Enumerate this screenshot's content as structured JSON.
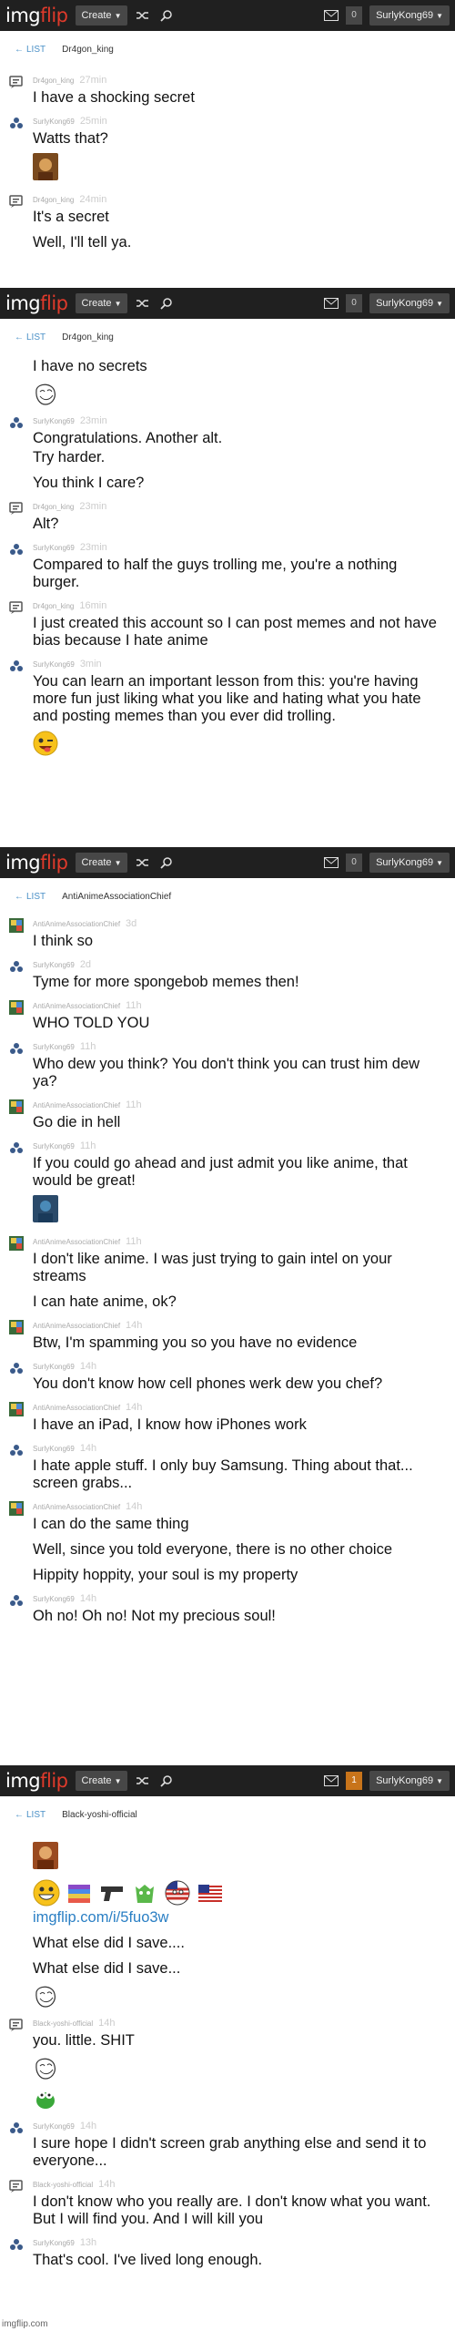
{
  "topbar": {
    "logo_main": "img",
    "logo_accent": "flip",
    "create_label": "Create",
    "username": "SurlyKong69",
    "notifications_panel1": "0",
    "notifications_panel4": "1"
  },
  "back_label": "LIST",
  "panel1": {
    "conversation": "Dr4gon_king",
    "messages": [
      {
        "user": "Dr4gon_king",
        "time": "27min",
        "lines": [
          "I have a shocking secret"
        ]
      },
      {
        "user": "SurlyKong69",
        "time": "25min",
        "lines": [
          "Watts that?"
        ]
      },
      {
        "user": "Dr4gon_king",
        "time": "24min",
        "lines": [
          "It's a secret",
          "Well, I'll tell ya."
        ]
      }
    ]
  },
  "panel2": {
    "conversation": "Dr4gon_king",
    "messages": [
      {
        "lines": [
          "I have no secrets"
        ]
      },
      {
        "user": "SurlyKong69",
        "time": "23min",
        "lines": [
          "Congratulations. Another alt.",
          "Try harder.",
          "You think I care?"
        ]
      },
      {
        "user": "Dr4gon_king",
        "time": "23min",
        "lines": [
          "Alt?"
        ]
      },
      {
        "user": "SurlyKong69",
        "time": "23min",
        "lines": [
          "Compared to half the guys trolling me, you're a nothing burger."
        ]
      },
      {
        "user": "Dr4gon_king",
        "time": "16min",
        "lines": [
          "I just created this account so I can post memes and not have bias because I hate anime"
        ]
      },
      {
        "user": "SurlyKong69",
        "time": "3min",
        "lines": [
          "You can learn an important lesson from this: you're having more fun just liking what you like and hating what you hate and posting memes than you ever did trolling."
        ]
      }
    ]
  },
  "panel3": {
    "conversation": "AntiAnimeAssociationChief",
    "messages": [
      {
        "user": "AntiAnimeAssociationChief",
        "time": "3d",
        "lines": [
          "I think so"
        ]
      },
      {
        "user": "SurlyKong69",
        "time": "2d",
        "lines": [
          "Tyme for more spongebob memes then!"
        ]
      },
      {
        "user": "AntiAnimeAssociationChief",
        "time": "11h",
        "lines": [
          "WHO TOLD YOU"
        ]
      },
      {
        "user": "SurlyKong69",
        "time": "11h",
        "lines": [
          "Who dew you think? You don't think you can trust him dew ya?"
        ]
      },
      {
        "user": "AntiAnimeAssociationChief",
        "time": "11h",
        "lines": [
          "Go die in hell"
        ]
      },
      {
        "user": "SurlyKong69",
        "time": "11h",
        "lines": [
          "If you could go ahead and just admit you like anime, that would be great!"
        ]
      },
      {
        "user": "AntiAnimeAssociationChief",
        "time": "11h",
        "lines": [
          "I don't like anime. I was just trying to gain intel on your streams",
          "I can hate anime, ok?"
        ]
      },
      {
        "user": "AntiAnimeAssociationChief",
        "time": "14h",
        "lines": [
          "Btw, I'm spamming you so you have no evidence"
        ]
      },
      {
        "user": "SurlyKong69",
        "time": "14h",
        "lines": [
          "You don't know how cell phones werk dew you chef?"
        ]
      },
      {
        "user": "AntiAnimeAssociationChief",
        "time": "14h",
        "lines": [
          "I have an iPad, I know how iPhones work"
        ]
      },
      {
        "user": "SurlyKong69",
        "time": "14h",
        "lines": [
          "I hate apple stuff. I only buy Samsung. Thing about that... screen grabs..."
        ]
      },
      {
        "user": "AntiAnimeAssociationChief",
        "time": "14h",
        "lines": [
          "I can do the same thing",
          "Well, since you told everyone, there is no other choice",
          "Hippity hoppity, your soul is my property"
        ]
      },
      {
        "user": "SurlyKong69",
        "time": "14h",
        "lines": [
          "Oh no! Oh no! Not my precious soul!"
        ]
      }
    ]
  },
  "panel4": {
    "conversation": "Black-yoshi-official",
    "messages": [
      {
        "lines": [
          "imgflip.com/i/5fuo3w",
          "What else did I save....",
          "What else did I save..."
        ]
      },
      {
        "user": "Black-yoshi-official",
        "time": "14h",
        "lines": [
          "you. little. SHIT"
        ]
      },
      {
        "user": "SurlyKong69",
        "time": "14h",
        "lines": [
          "I sure hope I didn't screen grab anything else and send it to everyone..."
        ]
      },
      {
        "user": "Black-yoshi-official",
        "time": "14h",
        "lines": [
          "I don't know who you really are. I don't know what you want. But I will find you. And I will kill you"
        ]
      },
      {
        "user": "SurlyKong69",
        "time": "13h",
        "lines": [
          "That's cool. I've lived long enough."
        ]
      }
    ]
  },
  "watermark": "imgflip.com"
}
